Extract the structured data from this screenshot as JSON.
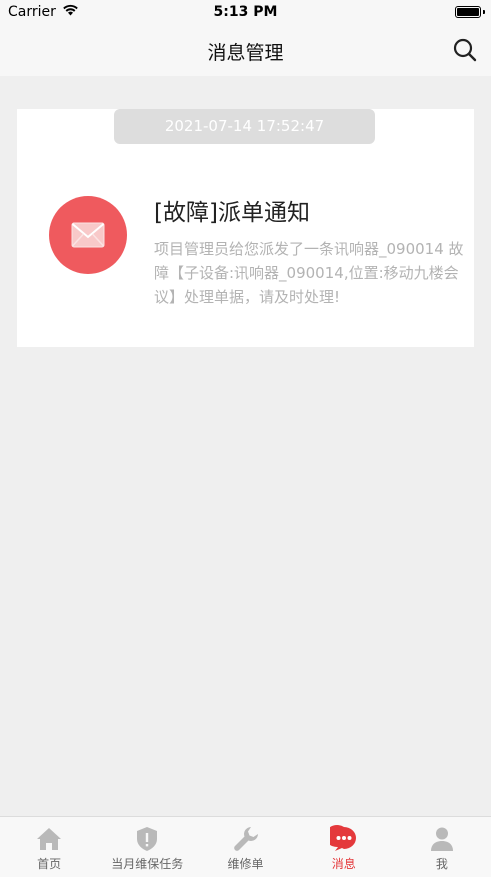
{
  "status_bar": {
    "carrier": "Carrier",
    "time": "5:13 PM"
  },
  "nav": {
    "title": "消息管理",
    "search_icon": "search-icon"
  },
  "message": {
    "timestamp": "2021-07-14 17:52:47",
    "title": "[故障]派单通知",
    "body": "项目管理员给您派发了一条讯响器_090014 故障【子设备:讯响器_090014,位置:移动九楼会议】处理单据，请及时处理!",
    "icon": "envelope-icon",
    "icon_color": "#ef5a5e"
  },
  "tabs": [
    {
      "label": "首页",
      "icon": "home-icon"
    },
    {
      "label": "当月维保任务",
      "icon": "shield-icon"
    },
    {
      "label": "维修单",
      "icon": "wrench-icon"
    },
    {
      "label": "消息",
      "icon": "chat-icon",
      "active": true
    },
    {
      "label": "我",
      "icon": "person-icon"
    }
  ],
  "colors": {
    "accent": "#e4393c",
    "inactive_icon": "#b9b9b9"
  }
}
